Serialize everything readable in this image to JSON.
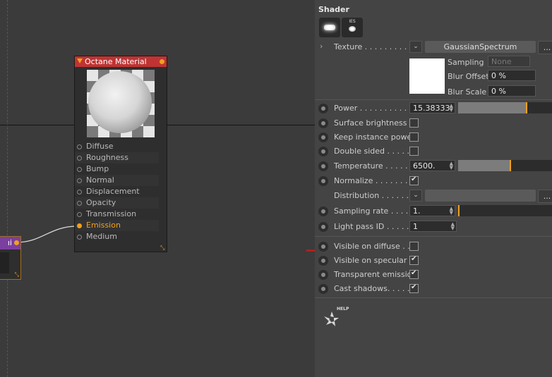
{
  "node_editor": {
    "material_node": {
      "title": "Octane Material",
      "pins": [
        "Diffuse",
        "Roughness",
        "Bump",
        "Normal",
        "Displacement",
        "Opacity",
        "Transmission",
        "Emission",
        "Medium"
      ],
      "active_pin": "Emission"
    },
    "left_node": {
      "title_fragment": "ıi"
    }
  },
  "panel": {
    "title": "Shader",
    "tabs": [
      {
        "icon": "lamp-icon"
      },
      {
        "icon": "ies-icon",
        "label": "IES"
      }
    ],
    "texture": {
      "label": "Texture . . . . . . . . . .",
      "value": "GaussianSpectrum",
      "more": "..."
    },
    "sampling": {
      "label": "Sampling",
      "value": "None"
    },
    "blur_offset": {
      "label": "Blur Offset",
      "value": "0 %"
    },
    "blur_scale": {
      "label": "Blur Scale",
      "value": "0 %"
    },
    "power": {
      "label": "Power . . . . . . . . . . .",
      "value": "15.38333",
      "fraction": 0.72
    },
    "surface_brightness": {
      "label": "Surface brightness",
      "checked": false
    },
    "keep_instance_power": {
      "label": "Keep instance power",
      "checked": false
    },
    "double_sided": {
      "label": "Double sided . . . . .",
      "checked": false
    },
    "temperature": {
      "label": "Temperature . . . . .",
      "value": "6500.",
      "fraction": 0.55
    },
    "normalize": {
      "label": "Normalize . . . . . . .",
      "checked": true
    },
    "distribution": {
      "label": "Distribution . . . . . .",
      "more": "..."
    },
    "sampling_rate": {
      "label": "Sampling rate . . . .",
      "value": "1."
    },
    "light_pass_id": {
      "label": "Light pass ID . . . . .",
      "value": "1"
    },
    "visible_on_diffuse": {
      "label": "Visible on diffuse . .",
      "checked": false
    },
    "visible_on_specular": {
      "label": "Visible on specular .",
      "checked": true
    },
    "transparent_emission": {
      "label": "Transparent emission",
      "checked": true
    },
    "cast_shadows": {
      "label": "Cast shadows. . . . .",
      "checked": true
    },
    "help_label": "HELP",
    "colors": {
      "accent": "#f0a020",
      "annotation": "#cc1e1e",
      "header_red": "#c03333"
    }
  }
}
